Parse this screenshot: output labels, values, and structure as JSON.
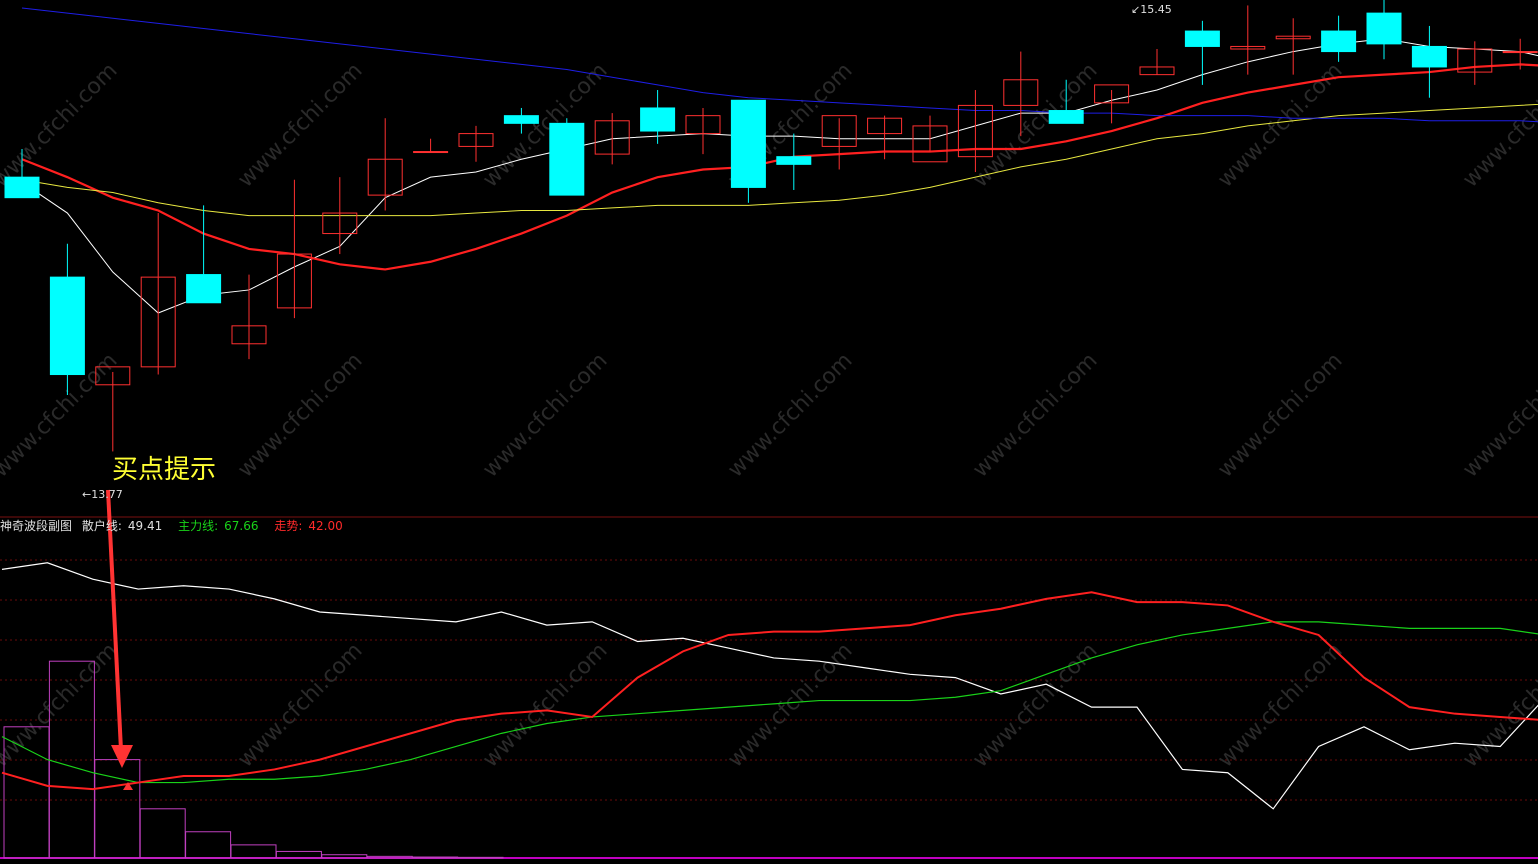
{
  "chart_data": [
    {
      "type": "candlestick",
      "panel": "main",
      "annotation": "买点提示",
      "high_marker": "15.45",
      "low_marker": "13.77",
      "ylim": [
        13.6,
        15.5
      ],
      "candles": [
        {
          "o": 14.84,
          "h": 14.95,
          "l": 14.76,
          "c": 14.76
        },
        {
          "o": 14.45,
          "h": 14.58,
          "l": 13.99,
          "c": 14.07
        },
        {
          "o": 14.03,
          "h": 14.08,
          "l": 13.77,
          "c": 14.1
        },
        {
          "o": 14.1,
          "h": 14.7,
          "l": 14.07,
          "c": 14.45
        },
        {
          "o": 14.46,
          "h": 14.73,
          "l": 14.39,
          "c": 14.35
        },
        {
          "o": 14.19,
          "h": 14.46,
          "l": 14.13,
          "c": 14.26
        },
        {
          "o": 14.33,
          "h": 14.83,
          "l": 14.29,
          "c": 14.54
        },
        {
          "o": 14.62,
          "h": 14.84,
          "l": 14.54,
          "c": 14.7
        },
        {
          "o": 14.77,
          "h": 15.07,
          "l": 14.71,
          "c": 14.91
        },
        {
          "o": 14.94,
          "h": 14.99,
          "l": 14.94,
          "c": 14.94
        },
        {
          "o": 14.96,
          "h": 15.04,
          "l": 14.9,
          "c": 15.01
        },
        {
          "o": 15.08,
          "h": 15.11,
          "l": 15.01,
          "c": 15.05
        },
        {
          "o": 15.05,
          "h": 15.07,
          "l": 14.81,
          "c": 14.77
        },
        {
          "o": 14.93,
          "h": 15.09,
          "l": 14.89,
          "c": 15.06
        },
        {
          "o": 15.11,
          "h": 15.18,
          "l": 14.97,
          "c": 15.02
        },
        {
          "o": 15.01,
          "h": 15.11,
          "l": 14.93,
          "c": 15.08
        },
        {
          "o": 15.14,
          "h": 15.14,
          "l": 14.74,
          "c": 14.8
        },
        {
          "o": 14.92,
          "h": 15.01,
          "l": 14.79,
          "c": 14.89
        },
        {
          "o": 14.96,
          "h": 15.07,
          "l": 14.87,
          "c": 15.08
        },
        {
          "o": 15.01,
          "h": 15.08,
          "l": 14.91,
          "c": 15.07
        },
        {
          "o": 14.9,
          "h": 15.08,
          "l": 14.94,
          "c": 15.04
        },
        {
          "o": 14.92,
          "h": 15.18,
          "l": 14.86,
          "c": 15.12
        },
        {
          "o": 15.12,
          "h": 15.33,
          "l": 15.0,
          "c": 15.22
        },
        {
          "o": 15.1,
          "h": 15.22,
          "l": 15.08,
          "c": 15.05
        },
        {
          "o": 15.13,
          "h": 15.18,
          "l": 15.05,
          "c": 15.2
        },
        {
          "o": 15.24,
          "h": 15.34,
          "l": 15.24,
          "c": 15.27
        },
        {
          "o": 15.41,
          "h": 15.45,
          "l": 15.2,
          "c": 15.35
        },
        {
          "o": 15.34,
          "h": 15.51,
          "l": 15.24,
          "c": 15.35
        },
        {
          "o": 15.38,
          "h": 15.46,
          "l": 15.24,
          "c": 15.39
        },
        {
          "o": 15.41,
          "h": 15.47,
          "l": 15.29,
          "c": 15.33
        },
        {
          "o": 15.48,
          "h": 15.55,
          "l": 15.3,
          "c": 15.36
        },
        {
          "o": 15.35,
          "h": 15.43,
          "l": 15.15,
          "c": 15.27
        },
        {
          "o": 15.25,
          "h": 15.37,
          "l": 15.2,
          "c": 15.34
        },
        {
          "o": 15.33,
          "h": 15.38,
          "l": 15.26,
          "c": 15.33
        },
        {
          "o": 15.33,
          "h": 15.38,
          "l": 15.26,
          "c": 15.27
        }
      ],
      "ma": [
        {
          "name": "MA5",
          "color": "#ffffff",
          "values": [
            14.82,
            14.7,
            14.47,
            14.31,
            14.38,
            14.4,
            14.49,
            14.57,
            14.76,
            14.84,
            14.86,
            14.91,
            14.95,
            14.99,
            15.0,
            15.01,
            15.0,
            15.0,
            14.99,
            14.99,
            14.99,
            15.04,
            15.09,
            15.09,
            15.14,
            15.18,
            15.24,
            15.29,
            15.33,
            15.36,
            15.38,
            15.35,
            15.34,
            15.33,
            15.29
          ]
        },
        {
          "name": "MA10",
          "color": "#ff2020",
          "values": [
            14.91,
            14.84,
            14.76,
            14.71,
            14.62,
            14.56,
            14.54,
            14.5,
            14.48,
            14.51,
            14.56,
            14.62,
            14.69,
            14.78,
            14.84,
            14.87,
            14.88,
            14.92,
            14.93,
            14.94,
            14.94,
            14.95,
            14.95,
            14.98,
            15.02,
            15.07,
            15.13,
            15.17,
            15.2,
            15.23,
            15.24,
            15.25,
            15.27,
            15.28,
            15.27
          ]
        },
        {
          "name": "MA20",
          "color": "#e8e840",
          "values": [
            14.83,
            14.8,
            14.78,
            14.74,
            14.71,
            14.69,
            14.69,
            14.69,
            14.69,
            14.69,
            14.7,
            14.71,
            14.71,
            14.72,
            14.73,
            14.73,
            14.73,
            14.74,
            14.75,
            14.77,
            14.8,
            14.84,
            14.88,
            14.91,
            14.95,
            14.99,
            15.01,
            15.04,
            15.06,
            15.08,
            15.09,
            15.1,
            15.11,
            15.12,
            15.13
          ]
        },
        {
          "name": "MA60",
          "color": "#1e1ee6",
          "values": [
            15.5,
            15.48,
            15.46,
            15.44,
            15.42,
            15.4,
            15.38,
            15.36,
            15.34,
            15.32,
            15.3,
            15.28,
            15.26,
            15.23,
            15.2,
            15.17,
            15.15,
            15.14,
            15.13,
            15.12,
            15.11,
            15.1,
            15.1,
            15.09,
            15.09,
            15.08,
            15.08,
            15.08,
            15.07,
            15.07,
            15.07,
            15.06,
            15.06,
            15.06,
            15.05
          ]
        }
      ]
    },
    {
      "type": "line",
      "panel": "indicator",
      "title": "神奇波段副图",
      "ylim": [
        0,
        100
      ],
      "series": [
        {
          "name": "散户线",
          "label": "散户线:",
          "value_label": "49.41",
          "color": "#ffffff",
          "values": [
            88,
            90,
            85,
            82,
            83,
            82,
            79,
            75,
            74,
            73,
            72,
            75,
            71,
            72,
            66,
            67,
            64,
            61,
            60,
            58,
            56,
            55,
            50,
            53,
            46,
            46,
            27,
            26,
            15,
            34,
            40,
            33,
            35,
            34,
            49
          ]
        },
        {
          "name": "主力线",
          "label": "主力线:",
          "value_label": "67.66",
          "color": "#19d219",
          "values": [
            37,
            30,
            26,
            23,
            23,
            24,
            24,
            25,
            27,
            30,
            34,
            38,
            41,
            43,
            44,
            45,
            46,
            47,
            48,
            48,
            48,
            49,
            51,
            56,
            61,
            65,
            68,
            70,
            72,
            72,
            71,
            70,
            70,
            70,
            68
          ]
        },
        {
          "name": "走势",
          "label": "走势:",
          "value_label": "42.00",
          "color": "#ff2020",
          "values": [
            26,
            22,
            21,
            23,
            25,
            25,
            27,
            30,
            34,
            38,
            42,
            44,
            45,
            43,
            55,
            63,
            68,
            69,
            69,
            70,
            71,
            74,
            76,
            79,
            81,
            78,
            78,
            77,
            72,
            68,
            55,
            46,
            44,
            43,
            42
          ]
        }
      ],
      "histogram": {
        "color": "#c040c0",
        "values": [
          40,
          60,
          30,
          15,
          8,
          4,
          2,
          1,
          0.5,
          0.3,
          0.2
        ]
      }
    }
  ],
  "watermark": "www.cfchi.com"
}
